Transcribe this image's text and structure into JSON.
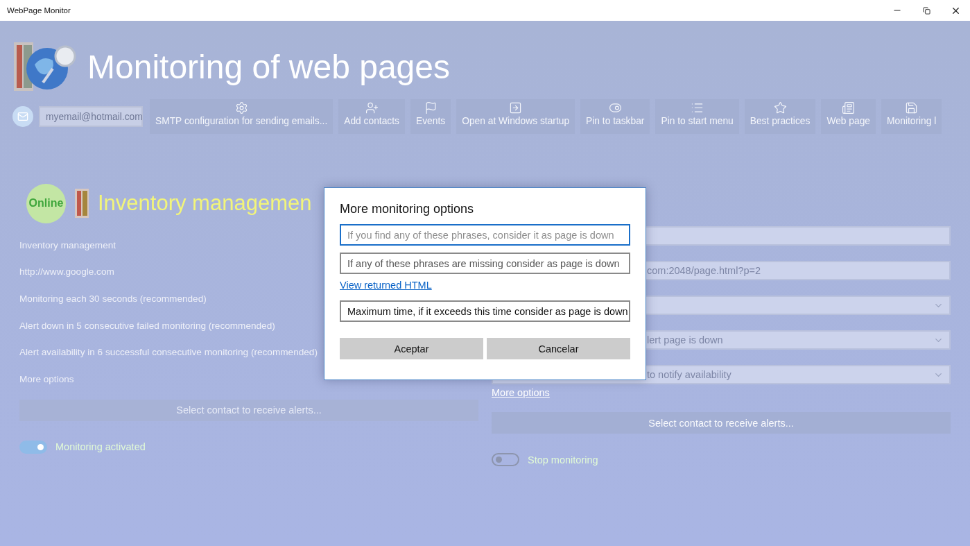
{
  "window": {
    "title": "WebPage Monitor"
  },
  "header": {
    "title": "Monitoring of web pages"
  },
  "toolbar": {
    "email": "myemail@hotmail.com",
    "buttons": [
      {
        "label": "SMTP configuration for sending emails..."
      },
      {
        "label": "Add contacts"
      },
      {
        "label": "Events"
      },
      {
        "label": "Open at Windows startup"
      },
      {
        "label": "Pin to taskbar"
      },
      {
        "label": "Pin to start menu"
      },
      {
        "label": "Best practices"
      },
      {
        "label": "Web page"
      },
      {
        "label": "Monitoring l"
      }
    ]
  },
  "left_panel": {
    "status": "Online",
    "name": "Inventory managemen",
    "details": [
      "Inventory management",
      "http://www.google.com",
      "Monitoring each 30 seconds (recommended)",
      "Alert down in 5 consecutive failed monitoring (recommended)",
      "Alert availability in 6 successful consecutive monitoring (recommended)",
      "More options"
    ],
    "contact_button": "Select contact to receive alerts...",
    "toggle": {
      "label": "Monitoring activated",
      "on": true
    }
  },
  "right_panel": {
    "fields": [
      {
        "kind": "text"
      },
      {
        "kind": "text",
        "placeholder": "com:2048/page.html?p=2"
      },
      {
        "kind": "dropdown"
      },
      {
        "kind": "dropdown",
        "value": "lert page is down"
      },
      {
        "kind": "dropdown",
        "value": "to notify availability"
      }
    ],
    "more_options": "More options",
    "contact_button": "Select contact to receive alerts...",
    "toggle": {
      "label": "Stop monitoring",
      "on": false
    }
  },
  "dialog": {
    "title": "More monitoring options",
    "fields": [
      {
        "placeholder": "If you find any of these phrases, consider it as page is down",
        "focused": true
      },
      {
        "placeholder": "If any of these phrases are missing consider as page is down",
        "focused": false
      }
    ],
    "link": "View returned HTML",
    "dropdown": {
      "value": "Maximum time, if it exceeds this time consider as page is down"
    },
    "buttons": [
      "Aceptar",
      "Cancelar"
    ]
  }
}
